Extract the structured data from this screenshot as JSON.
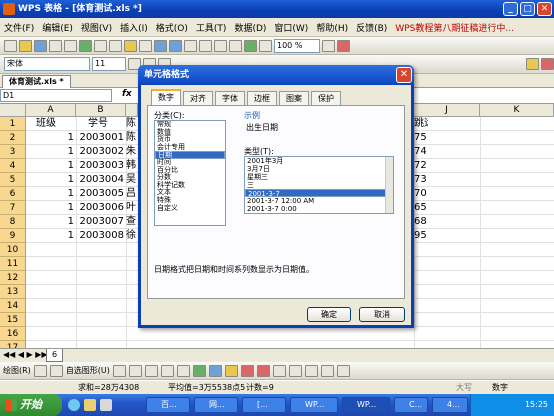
{
  "window": {
    "title": "WPS 表格 - [体育测试.xls *]"
  },
  "menu": {
    "items": [
      "文件(F)",
      "编辑(E)",
      "视图(V)",
      "插入(I)",
      "格式(O)",
      "工具(T)",
      "数据(D)",
      "窗口(W)",
      "帮助(H)",
      "反馈(B)"
    ],
    "promo": "WPS教程第八期征稿进行中..."
  },
  "toolbar": {
    "zoom": "100 %",
    "font": "宋体",
    "size": "11"
  },
  "file_tab": "体育测试.xls *",
  "formula": {
    "namebox": "D1",
    "fx": "fx"
  },
  "grid": {
    "columns": [
      "A",
      "B",
      "J",
      "K"
    ],
    "rows": [
      "1",
      "2",
      "3",
      "4",
      "5",
      "6",
      "7",
      "8",
      "9",
      "10",
      "11",
      "12",
      "13",
      "14",
      "15",
      "16",
      "17"
    ],
    "header": {
      "a": "班级",
      "b": "学号",
      "c_partial": "陈",
      "far_right": "跳远"
    },
    "data": [
      {
        "a": "1",
        "b": "2003001",
        "c": "陈",
        "i": "75"
      },
      {
        "a": "1",
        "b": "2003002",
        "c": "朱",
        "i": "74"
      },
      {
        "a": "1",
        "b": "2003003",
        "c": "韩",
        "i": "72"
      },
      {
        "a": "1",
        "b": "2003004",
        "c": "吴",
        "i": "73"
      },
      {
        "a": "1",
        "b": "2003005",
        "c": "吕",
        "i": "70"
      },
      {
        "a": "1",
        "b": "2003006",
        "c": "叶",
        "i": "65"
      },
      {
        "a": "1",
        "b": "2003007",
        "c": "查",
        "i": "68"
      },
      {
        "a": "1",
        "b": "2003008",
        "c": "徐",
        "i": "95"
      }
    ]
  },
  "sheet": {
    "tab": "6"
  },
  "drawbar": {
    "draw": "绘图(R)",
    "autoshape": "自选图形(U)"
  },
  "statusbar": {
    "sum": "求和=28万4308",
    "avg": "平均值=3万5538点5",
    "count": "计数=9",
    "caps": "大写",
    "num": "数字"
  },
  "dialog": {
    "title": "单元格格式",
    "tabs": [
      "数字",
      "对齐",
      "字体",
      "边框",
      "图案",
      "保护"
    ],
    "category_label": "分类(C):",
    "categories": [
      "常规",
      "数值",
      "货币",
      "会计专用",
      "日期",
      "时间",
      "百分比",
      "分数",
      "科学记数",
      "文本",
      "特殊",
      "自定义"
    ],
    "selected_category": 4,
    "sample_label": "示例",
    "sample_value": "出生日期",
    "type_label": "类型(T):",
    "types": [
      "2001年3月",
      "3月7日",
      "星期三",
      "三",
      "2001-3-7",
      "2001-3-7 12:00 AM",
      "2001-3-7 0:00"
    ],
    "selected_type": 4,
    "description": "日期格式把日期和时间系列数显示为日期值。",
    "ok": "确定",
    "cancel": "取消"
  },
  "taskbar": {
    "start": "开始",
    "buttons": [
      "百...",
      "网...",
      "[...",
      "WP...",
      "WP...",
      "C...",
      "4..."
    ],
    "clock": "15:25"
  }
}
